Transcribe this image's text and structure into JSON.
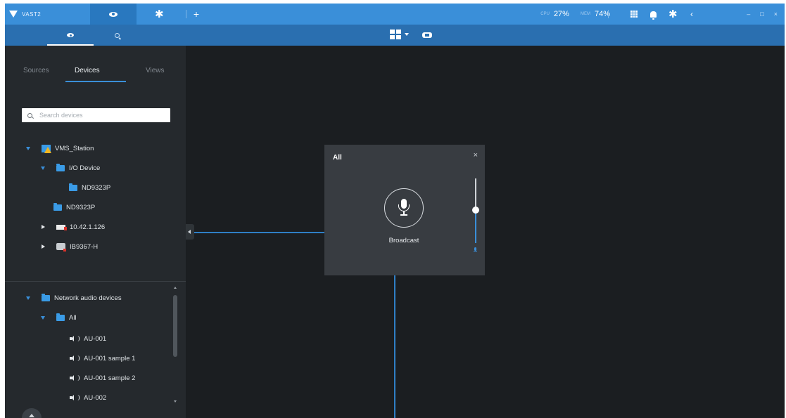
{
  "app": {
    "name": "VAST2"
  },
  "header": {
    "tabs": [
      {
        "name": "live-view",
        "icon": "eye-icon",
        "active": true
      },
      {
        "name": "settings",
        "icon": "gear-icon",
        "active": false
      }
    ],
    "add_tab_label": "+",
    "stats": {
      "cpu_label": "CPU",
      "cpu_value": "27%",
      "mem_label": "MEM",
      "mem_value": "74%"
    },
    "icons": [
      "grid-icon",
      "bell-icon",
      "gear-icon",
      "back-icon"
    ],
    "window_controls": [
      "minimize-icon",
      "maximize-icon",
      "close-icon"
    ]
  },
  "subbar": {
    "tabs": [
      {
        "name": "monitoring",
        "icon": "eye-icon",
        "active": true
      },
      {
        "name": "search",
        "icon": "search-icon",
        "active": false
      }
    ],
    "layout_icon": "quad-layout-icon",
    "view_toggle_icon": "film-icon"
  },
  "sidebar": {
    "tabs": [
      {
        "label": "Sources",
        "active": false
      },
      {
        "label": "Devices",
        "active": true
      },
      {
        "label": "Views",
        "active": false
      }
    ],
    "search": {
      "placeholder": "Search devices",
      "value": ""
    },
    "device_tree": [
      {
        "label": "VMS_Station",
        "icon": "station-warning-icon",
        "expanded": true
      },
      {
        "label": "I/O Device",
        "icon": "folder-icon",
        "expanded": true
      },
      {
        "label": "ND9323P",
        "icon": "folder-icon"
      },
      {
        "label": "ND9323P",
        "icon": "folder-icon"
      },
      {
        "label": "10.42.1.126",
        "icon": "camera-icon",
        "expanded": false
      },
      {
        "label": "IB9367-H",
        "icon": "camera-icon",
        "expanded": false
      }
    ],
    "audio_tree": [
      {
        "label": "Network audio devices",
        "icon": "folder-icon",
        "expanded": true
      },
      {
        "label": "All",
        "icon": "folder-icon",
        "expanded": true
      },
      {
        "label": "AU-001",
        "icon": "speaker-icon"
      },
      {
        "label": "AU-001 sample 1",
        "icon": "speaker-icon"
      },
      {
        "label": "AU-001 sample 2",
        "icon": "speaker-icon"
      },
      {
        "label": "AU-002",
        "icon": "speaker-icon"
      }
    ]
  },
  "popup": {
    "title": "All",
    "close_label": "×",
    "button_label": "Broadcast",
    "volume_level": 0.5
  },
  "colors": {
    "accent": "#3a8fd9",
    "topbar": "#3a8fd9",
    "subbar": "#2a6fb0",
    "sidebar": "#25292d",
    "canvas": "#1b1e21",
    "popup": "#383c41"
  }
}
